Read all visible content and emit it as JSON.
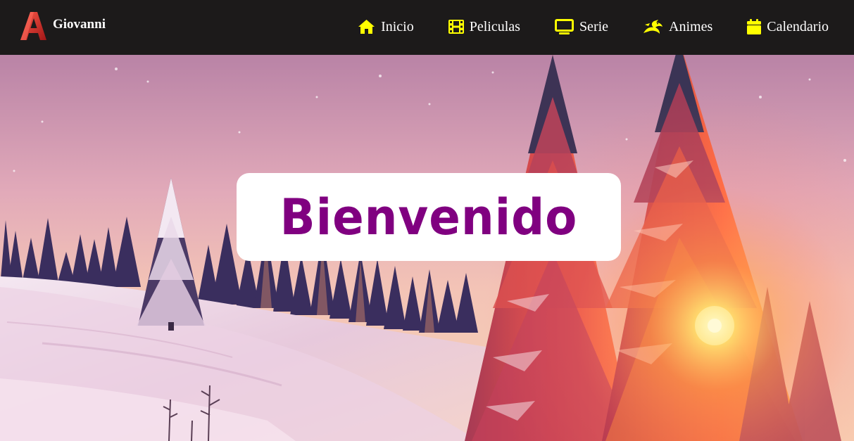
{
  "header": {
    "brand_name": "Giovanni",
    "logo_icon": "autocad-a-logo-icon",
    "nav": [
      {
        "label": "Inicio",
        "icon": "home-icon"
      },
      {
        "label": "Peliculas",
        "icon": "film-icon"
      },
      {
        "label": "Serie",
        "icon": "tv-icon"
      },
      {
        "label": "Animes",
        "icon": "dragon-icon"
      },
      {
        "label": "Calendario",
        "icon": "calendar-icon"
      }
    ]
  },
  "hero": {
    "title": "Bienvenido",
    "background": "snowy-forest-sunset-image"
  },
  "colors": {
    "header_bg": "#1c1a1a",
    "nav_icon": "#ffff00",
    "title": "#800080",
    "logo": "#d42a2a"
  }
}
